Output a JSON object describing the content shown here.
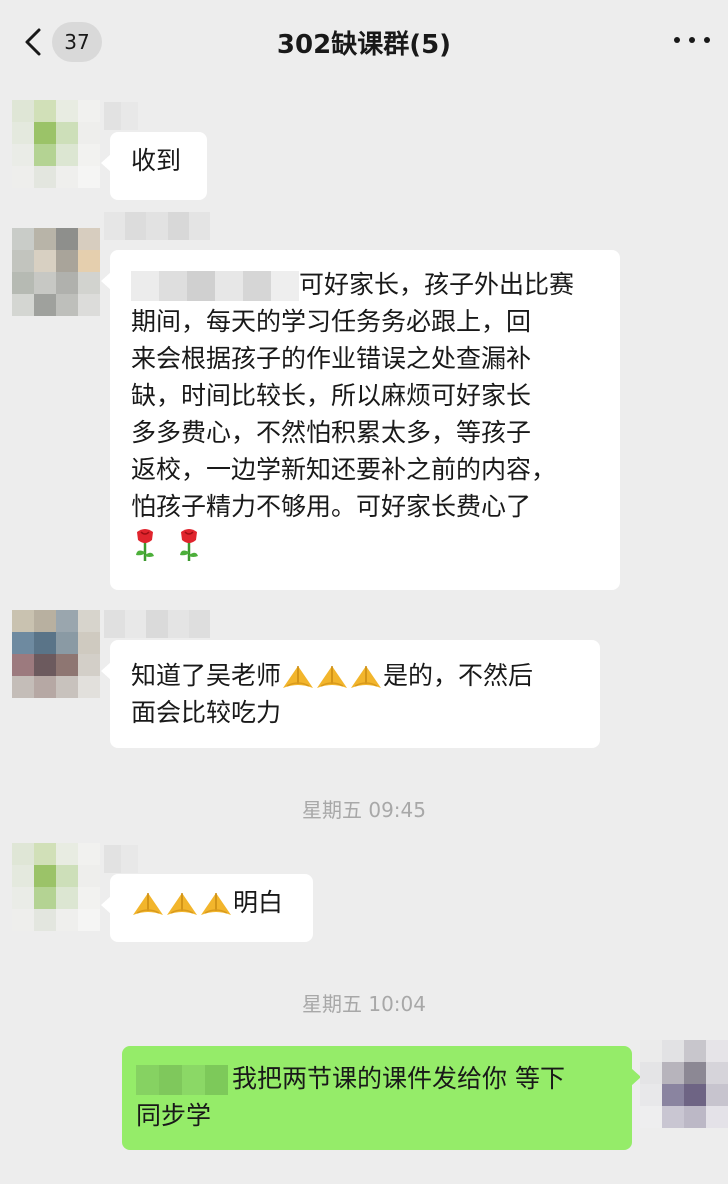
{
  "header": {
    "unread_count": "37",
    "title": "302缺课群(5)",
    "back_icon": "chevron-left-icon",
    "more_icon": "more-dots-icon"
  },
  "messages": [
    {
      "sender": "other",
      "text": "收到"
    },
    {
      "sender": "other",
      "lines": [
        "可好家长，孩子外出比赛",
        "期间，每天的学习任务务必跟上，回",
        "来会根据孩子的作业错误之处查漏补",
        "缺，时间比较长，所以麻烦可好家长",
        "多多费心，不然怕积累太多，等孩子",
        "返校，一边学新知还要补之前的内容，",
        "怕孩子精力不够用。可好家长费心了"
      ],
      "emoji": "rose-icon"
    },
    {
      "sender": "other",
      "line1_a": "知道了吴老师",
      "line1_b": "是的，不然后",
      "line2": "面会比较吃力",
      "emoji": "folded-hands-icon"
    },
    {
      "sender": "other",
      "text": "明白",
      "emoji": "folded-hands-icon"
    },
    {
      "sender": "me",
      "line1": "我把两节课的课件发给你 等下",
      "line2": "同步学"
    }
  ],
  "timestamps": [
    "星期五 09:45",
    "星期五 10:04"
  ]
}
